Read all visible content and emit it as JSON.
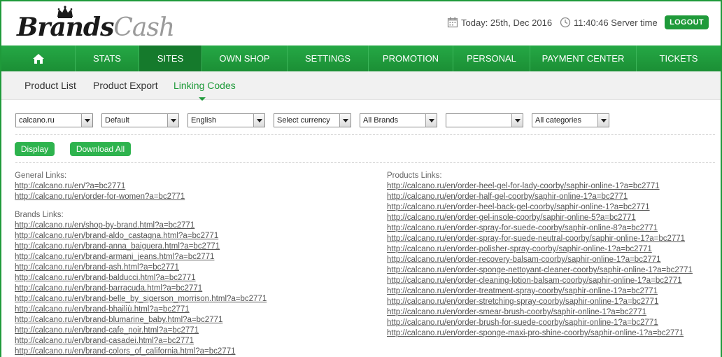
{
  "brand": {
    "logo_text_a": "Brands",
    "logo_text_b": "Cash"
  },
  "header": {
    "date_text": "Today: 25th, Dec 2016",
    "time_text": "11:40:46 Server time",
    "logout_label": "LOGOUT"
  },
  "nav": {
    "items": [
      {
        "label": "STATS"
      },
      {
        "label": "SITES"
      },
      {
        "label": "OWN SHOP"
      },
      {
        "label": "SETTINGS"
      },
      {
        "label": "PROMOTION"
      },
      {
        "label": "PERSONAL"
      },
      {
        "label": "PAYMENT CENTER"
      },
      {
        "label": "TICKETS"
      }
    ],
    "active": "SITES"
  },
  "subnav": {
    "items": [
      {
        "label": "Product List"
      },
      {
        "label": "Product Export"
      },
      {
        "label": "Linking Codes"
      }
    ],
    "active": "Linking Codes"
  },
  "filters": {
    "site": "calcano.ru",
    "sort": "Default",
    "language": "English",
    "currency": "Select currency",
    "brands": "All Brands",
    "blank": "",
    "categories": "All categories"
  },
  "buttons": {
    "display_label": "Display",
    "download_label": "Download All"
  },
  "general_links": {
    "label": "General Links:",
    "items": [
      "http://calcano.ru/en/?a=bc2771",
      "http://calcano.ru/en/order-for-women?a=bc2771"
    ]
  },
  "brands_links": {
    "label": "Brands Links:",
    "items": [
      "http://calcano.ru/en/shop-by-brand.html?a=bc2771",
      "http://calcano.ru/en/brand-aldo_castagna.html?a=bc2771",
      "http://calcano.ru/en/brand-anna_baiguera.html?a=bc2771",
      "http://calcano.ru/en/brand-armani_jeans.html?a=bc2771",
      "http://calcano.ru/en/brand-ash.html?a=bc2771",
      "http://calcano.ru/en/brand-balducci.html?a=bc2771",
      "http://calcano.ru/en/brand-barracuda.html?a=bc2771",
      "http://calcano.ru/en/brand-belle_by_sigerson_morrison.html?a=bc2771",
      "http://calcano.ru/en/brand-bhailiù.html?a=bc2771",
      "http://calcano.ru/en/brand-blumarine_baby.html?a=bc2771",
      "http://calcano.ru/en/brand-cafe_noir.html?a=bc2771",
      "http://calcano.ru/en/brand-casadei.html?a=bc2771",
      "http://calcano.ru/en/brand-colors_of_california.html?a=bc2771"
    ]
  },
  "products_links": {
    "label": "Products Links:",
    "items": [
      "http://calcano.ru/en/order-heel-gel-for-lady-coorby/saphir-online-1?a=bc2771",
      "http://calcano.ru/en/order-half-gel-coorby/saphir-online-1?a=bc2771",
      "http://calcano.ru/en/order-heel-back-gel-coorby/saphir-online-1?a=bc2771",
      "http://calcano.ru/en/order-gel-insole-coorby/saphir-online-5?a=bc2771",
      "http://calcano.ru/en/order-spray-for-suede-coorby/saphir-online-8?a=bc2771",
      "http://calcano.ru/en/order-spray-for-suede-neutral-coorby/saphir-online-1?a=bc2771",
      "http://calcano.ru/en/order-polisher-spray-coorby/saphir-online-1?a=bc2771",
      "http://calcano.ru/en/order-recovery-balsam-coorby/saphir-online-1?a=bc2771",
      "http://calcano.ru/en/order-sponge-nettoyant-cleaner-coorby/saphir-online-1?a=bc2771",
      "http://calcano.ru/en/order-cleaning-lotion-balsam-coorby/saphir-online-1?a=bc2771",
      "http://calcano.ru/en/order-treatment-spray-coorby/saphir-online-1?a=bc2771",
      "http://calcano.ru/en/order-stretching-spray-coorby/saphir-online-1?a=bc2771",
      "http://calcano.ru/en/order-smear-brush-coorby/saphir-online-1?a=bc2771",
      "http://calcano.ru/en/order-brush-for-suede-coorby/saphir-online-1?a=bc2771",
      "http://calcano.ru/en/order-sponge-maxi-pro-shine-coorby/saphir-online-1?a=bc2771"
    ]
  },
  "colors": {
    "accent": "#1f9a3a",
    "nav_active": "#157a2c",
    "button": "#2eb34e"
  },
  "icons": {
    "home": "home-icon",
    "calendar": "calendar-icon",
    "clock": "clock-icon",
    "crown": "crown-icon"
  }
}
